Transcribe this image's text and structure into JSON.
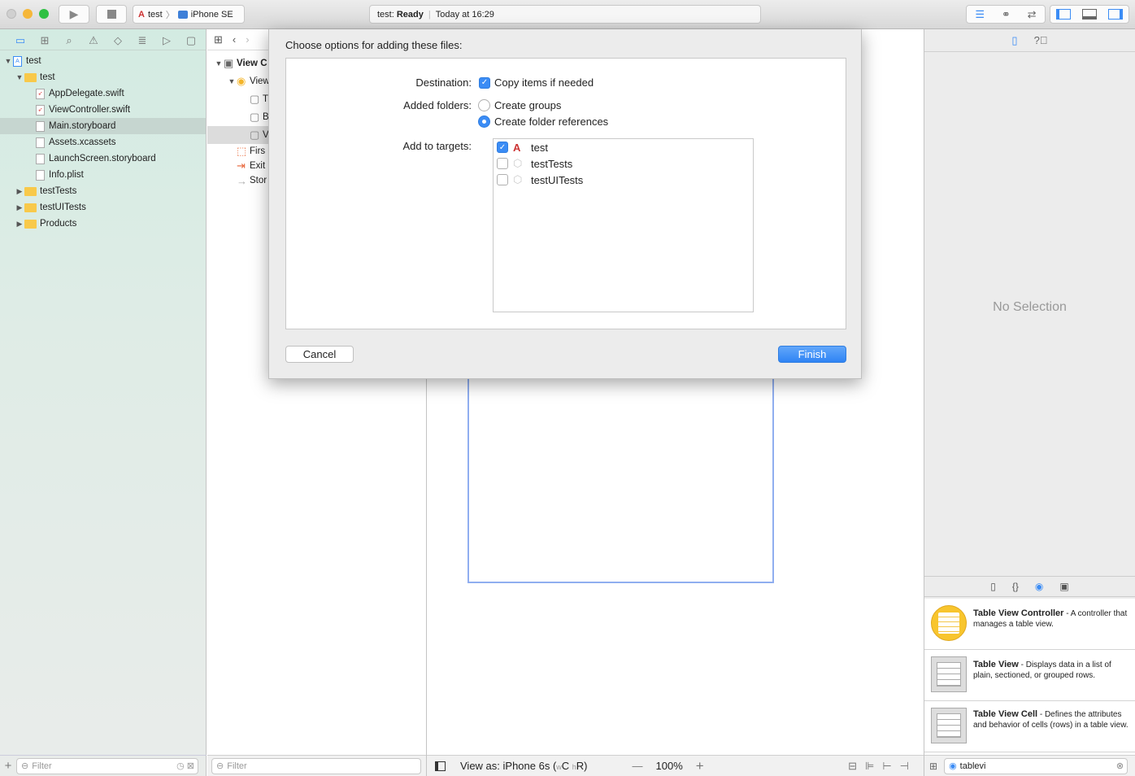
{
  "toolbar": {
    "scheme": "test",
    "device": "iPhone SE",
    "status_project": "test:",
    "status_state": "Ready",
    "status_time": "Today at 16:29"
  },
  "navigator": {
    "items": [
      {
        "label": "test",
        "level": 0,
        "kind": "project",
        "expanded": true
      },
      {
        "label": "test",
        "level": 1,
        "kind": "folder",
        "expanded": true
      },
      {
        "label": "AppDelegate.swift",
        "level": 2,
        "kind": "swift"
      },
      {
        "label": "ViewController.swift",
        "level": 2,
        "kind": "swift"
      },
      {
        "label": "Main.storyboard",
        "level": 2,
        "kind": "storyboard",
        "selected": true
      },
      {
        "label": "Assets.xcassets",
        "level": 2,
        "kind": "assets"
      },
      {
        "label": "LaunchScreen.storyboard",
        "level": 2,
        "kind": "storyboard"
      },
      {
        "label": "Info.plist",
        "level": 2,
        "kind": "plist"
      },
      {
        "label": "testTests",
        "level": 1,
        "kind": "folder",
        "expanded": false
      },
      {
        "label": "testUITests",
        "level": 1,
        "kind": "folder",
        "expanded": false
      },
      {
        "label": "Products",
        "level": 1,
        "kind": "folder",
        "expanded": false
      }
    ],
    "filter_placeholder": "Filter"
  },
  "outline": {
    "items": [
      "View C",
      "View",
      "T",
      "B",
      "V",
      "Firs",
      "Exit",
      "Stor"
    ],
    "filter_placeholder": "Filter"
  },
  "dialog": {
    "title": "Choose options for adding these files:",
    "destination_label": "Destination:",
    "copy_items": "Copy items if needed",
    "copy_checked": true,
    "added_folders_label": "Added folders:",
    "create_groups": "Create groups",
    "create_folder_refs": "Create folder references",
    "selected_folder_option": "Create folder references",
    "add_targets_label": "Add to targets:",
    "targets": [
      {
        "name": "test",
        "checked": true
      },
      {
        "name": "testTests",
        "checked": false
      },
      {
        "name": "testUITests",
        "checked": false
      }
    ],
    "cancel": "Cancel",
    "finish": "Finish",
    "accent": "#3b8cf5"
  },
  "canvas": {
    "view_as": "View as: iPhone 6s (",
    "size_w": "w",
    "size_c": "C ",
    "size_h": "h",
    "size_r": "R)",
    "zoom": "100%"
  },
  "inspector": {
    "empty": "No Selection",
    "library": [
      {
        "title": "Table View Controller",
        "desc": " - A controller that manages a table view."
      },
      {
        "title": "Table View",
        "desc": " - Displays data in a list of plain, sectioned, or grouped rows."
      },
      {
        "title": "Table View Cell",
        "desc": " - Defines the attributes and behavior of cells (rows) in a table view."
      }
    ],
    "search_value": "tablevi"
  }
}
